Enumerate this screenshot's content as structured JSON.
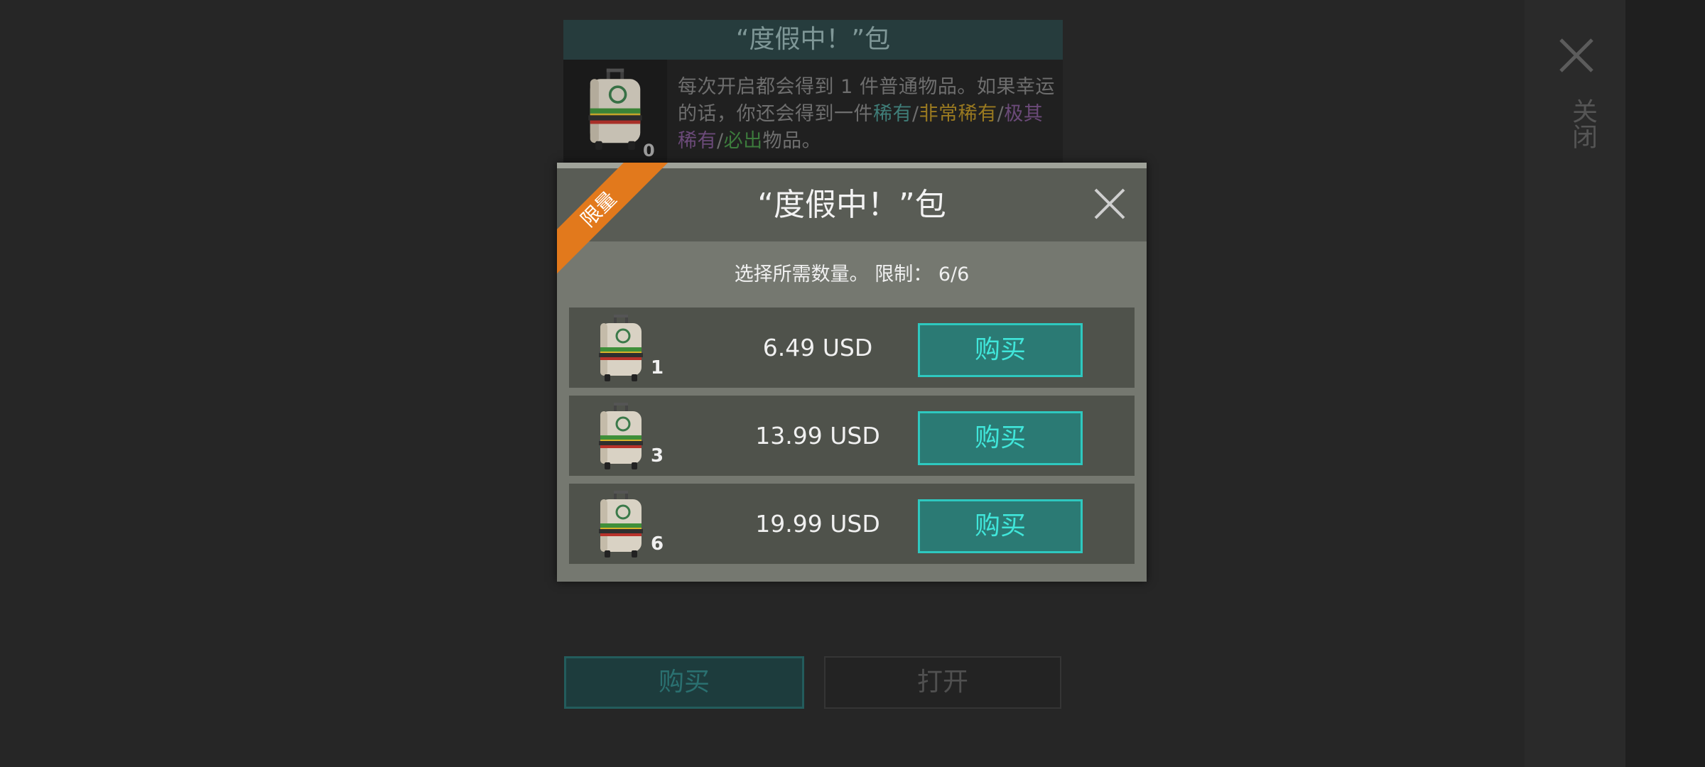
{
  "colors": {
    "accent": "#2b7a74",
    "accent_text": "#40e6da",
    "ribbon": "#e2791c",
    "background": "#262626"
  },
  "side_close": {
    "icon": "close-icon",
    "label": "关闭"
  },
  "info_card": {
    "title": "“度假中！”包",
    "owned_count": "0",
    "description_parts": {
      "p1": "每次开启都会得到 1 件普通物品。如果幸运的话，你还会得到一件",
      "rare": "稀有",
      "sep1": "/",
      "very_rare": "非常稀有",
      "sep2": "/",
      "extremely_rare": "极其稀有",
      "sep3": "/",
      "guaranteed": "必出",
      "end": "物品。"
    }
  },
  "bottom_buttons": {
    "buy_label": "购买",
    "open_label": "打开"
  },
  "modal": {
    "ribbon_label": "限量",
    "title": "“度假中！”包",
    "close_icon": "close-icon",
    "subtitle": "选择所需数量。 限制： 6/6",
    "options": [
      {
        "quantity": "1",
        "price": "6.49 USD",
        "buy_label": "购买"
      },
      {
        "quantity": "3",
        "price": "13.99 USD",
        "buy_label": "购买"
      },
      {
        "quantity": "6",
        "price": "19.99 USD",
        "buy_label": "购买"
      }
    ]
  }
}
